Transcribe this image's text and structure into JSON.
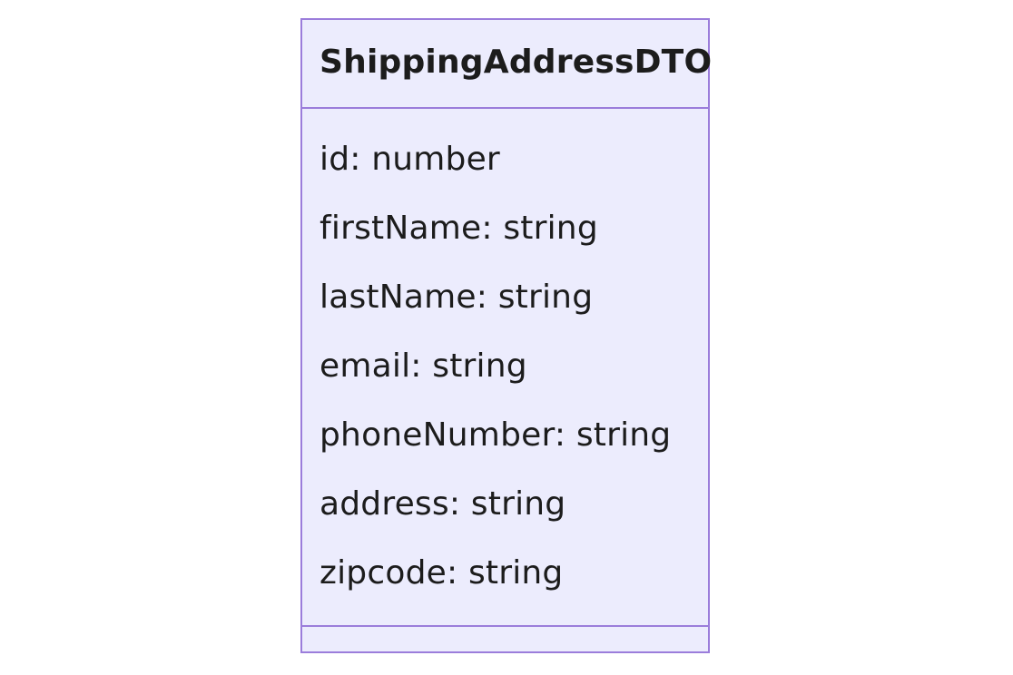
{
  "class": {
    "name": "ShippingAddressDTO",
    "attributes": [
      "id: number",
      "firstName: string",
      "lastName: string",
      "email: string",
      "phoneNumber: string",
      "address: string",
      "zipcode: string"
    ],
    "methods": []
  },
  "colors": {
    "box_fill": "#ececfd",
    "box_border": "#9b7ddb",
    "text": "#1c1c1c"
  }
}
